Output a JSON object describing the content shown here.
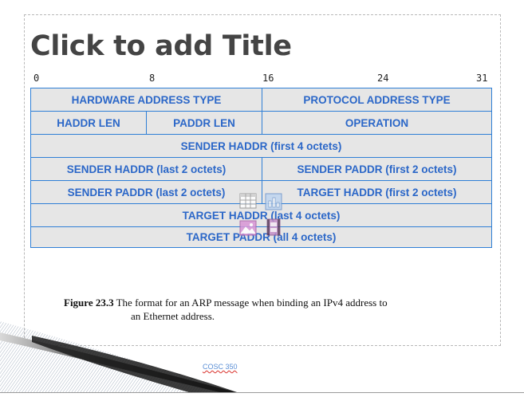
{
  "slide": {
    "title": "Click to add Title",
    "footer": "COSC 350"
  },
  "ruler": [
    "0",
    "8",
    "16",
    "24",
    "31"
  ],
  "arp_format": {
    "rows": [
      [
        {
          "label": "HARDWARE ADDRESS TYPE"
        },
        {
          "label": "PROTOCOL ADDRESS TYPE"
        }
      ],
      [
        {
          "label": "HADDR LEN"
        },
        {
          "label": "PADDR LEN"
        },
        {
          "label": "OPERATION"
        }
      ],
      [
        {
          "label": "SENDER HADDR (first 4 octets)"
        }
      ],
      [
        {
          "label": "SENDER HADDR (last 2 octets)"
        },
        {
          "label": "SENDER PADDR (first 2 octets)"
        }
      ],
      [
        {
          "label": "SENDER PADDR (last 2 octets)"
        },
        {
          "label": "TARGET HADDR (first 2 octets)"
        }
      ],
      [
        {
          "label": "TARGET HADDR (last 4 octets)"
        }
      ],
      [
        {
          "label": "TARGET PADDR (all 4 octets)"
        }
      ]
    ]
  },
  "caption": {
    "label": "Figure 23.3",
    "text_line1": "The format for an ARP message when binding an IPv4 address to",
    "text_line2": "an Ethernet address."
  },
  "content_placeholder_icons": [
    "table-icon",
    "chart-icon",
    "picture-icon",
    "media-icon"
  ],
  "colors": {
    "title": "#444444",
    "cell_text": "#2b67c8",
    "cell_border": "#2f7fd6",
    "cell_fill": "#e6e6e6",
    "footer": "#5b8fd6"
  }
}
